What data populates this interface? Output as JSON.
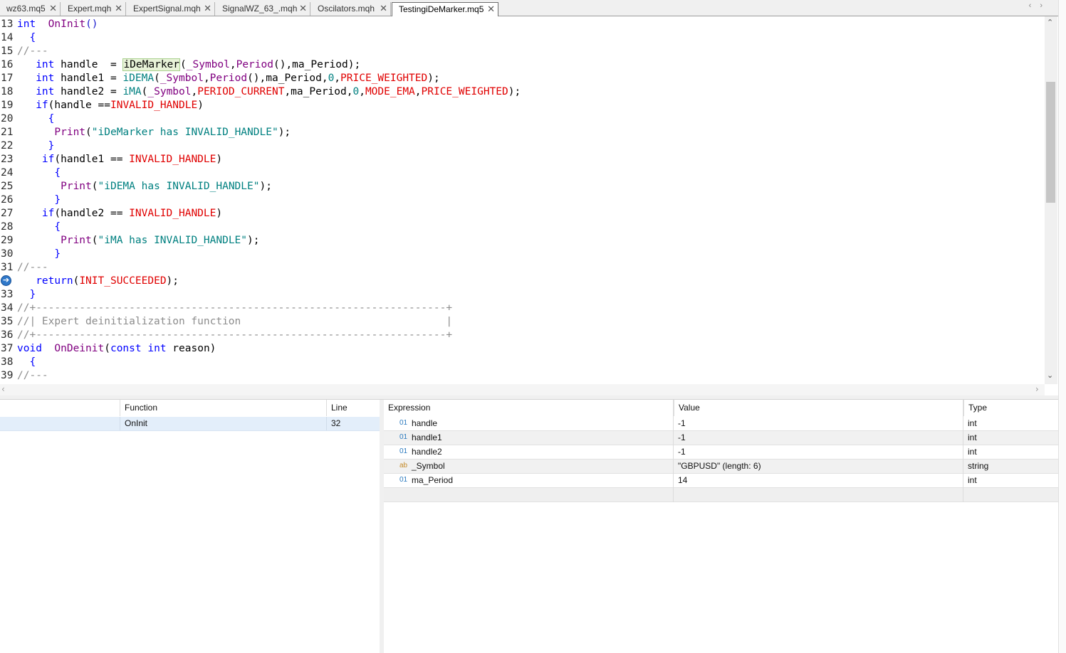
{
  "tabs": [
    {
      "label": "wz63.mq5",
      "active": false
    },
    {
      "label": "Expert.mqh",
      "active": false
    },
    {
      "label": "ExpertSignal.mqh",
      "active": false
    },
    {
      "label": "SignalWZ_63_.mqh",
      "active": false
    },
    {
      "label": "Oscilators.mqh",
      "active": false
    },
    {
      "label": "TestingiDeMarker.mq5",
      "active": true
    }
  ],
  "tab_close_glyph": "✕",
  "tab_nav": {
    "prev": "‹",
    "next": "›"
  },
  "code": {
    "lines": [
      {
        "n": "13",
        "tokens": [
          [
            "kw",
            "int"
          ],
          [
            "",
            "  "
          ],
          [
            "fn",
            "OnInit"
          ],
          [
            "bl",
            "()"
          ]
        ]
      },
      {
        "n": "14",
        "tokens": [
          [
            "",
            "  "
          ],
          [
            "kw",
            "{"
          ]
        ]
      },
      {
        "n": "15",
        "tokens": [
          [
            "cm",
            "//---"
          ]
        ]
      },
      {
        "n": "16",
        "tokens": [
          [
            "",
            "   "
          ],
          [
            "kw",
            "int"
          ],
          [
            "",
            " handle  = "
          ],
          [
            "hl",
            "iDeMarker"
          ],
          [
            "",
            "("
          ],
          [
            "fn",
            "_Symbol"
          ],
          [
            "",
            ","
          ],
          [
            "fn",
            "Period"
          ],
          [
            "",
            "(),ma_Period);"
          ]
        ]
      },
      {
        "n": "17",
        "tokens": [
          [
            "",
            "   "
          ],
          [
            "kw",
            "int"
          ],
          [
            "",
            " handle1 = "
          ],
          [
            "st",
            "iDEMA"
          ],
          [
            "",
            "("
          ],
          [
            "fn",
            "_Symbol"
          ],
          [
            "",
            ","
          ],
          [
            "fn",
            "Period"
          ],
          [
            "",
            "(),ma_Period,"
          ],
          [
            "st",
            "0"
          ],
          [
            "",
            ","
          ],
          [
            "cn",
            "PRICE_WEIGHTED"
          ],
          [
            "",
            ");"
          ]
        ]
      },
      {
        "n": "18",
        "tokens": [
          [
            "",
            "   "
          ],
          [
            "kw",
            "int"
          ],
          [
            "",
            " handle2 = "
          ],
          [
            "st",
            "iMA"
          ],
          [
            "",
            "("
          ],
          [
            "fn",
            "_Symbol"
          ],
          [
            "",
            ","
          ],
          [
            "cn",
            "PERIOD_CURRENT"
          ],
          [
            "",
            ",ma_Period,"
          ],
          [
            "st",
            "0"
          ],
          [
            "",
            ","
          ],
          [
            "cn",
            "MODE_EMA"
          ],
          [
            "",
            ","
          ],
          [
            "cn",
            "PRICE_WEIGHTED"
          ],
          [
            "",
            ");"
          ]
        ]
      },
      {
        "n": "19",
        "tokens": [
          [
            "",
            "   "
          ],
          [
            "kw",
            "if"
          ],
          [
            "",
            "(handle =="
          ],
          [
            "cn",
            "INVALID_HANDLE"
          ],
          [
            "",
            ")"
          ]
        ]
      },
      {
        "n": "20",
        "tokens": [
          [
            "",
            "     "
          ],
          [
            "kw",
            "{"
          ]
        ]
      },
      {
        "n": "21",
        "tokens": [
          [
            "",
            "      "
          ],
          [
            "fn",
            "Print"
          ],
          [
            "",
            "("
          ],
          [
            "st",
            "\"iDeMarker has INVALID_HANDLE\""
          ],
          [
            "",
            ");"
          ]
        ]
      },
      {
        "n": "22",
        "tokens": [
          [
            "",
            "     "
          ],
          [
            "kw",
            "}"
          ]
        ]
      },
      {
        "n": "23",
        "tokens": [
          [
            "",
            "    "
          ],
          [
            "kw",
            "if"
          ],
          [
            "",
            "(handle1 == "
          ],
          [
            "cn",
            "INVALID_HANDLE"
          ],
          [
            "",
            ")"
          ]
        ]
      },
      {
        "n": "24",
        "tokens": [
          [
            "",
            "      "
          ],
          [
            "kw",
            "{"
          ]
        ]
      },
      {
        "n": "25",
        "tokens": [
          [
            "",
            "       "
          ],
          [
            "fn",
            "Print"
          ],
          [
            "",
            "("
          ],
          [
            "st",
            "\"iDEMA has INVALID_HANDLE\""
          ],
          [
            "",
            ");"
          ]
        ]
      },
      {
        "n": "26",
        "tokens": [
          [
            "",
            "      "
          ],
          [
            "kw",
            "}"
          ]
        ]
      },
      {
        "n": "27",
        "tokens": [
          [
            "",
            "    "
          ],
          [
            "kw",
            "if"
          ],
          [
            "",
            "(handle2 == "
          ],
          [
            "cn",
            "INVALID_HANDLE"
          ],
          [
            "",
            ")"
          ]
        ]
      },
      {
        "n": "28",
        "tokens": [
          [
            "",
            "      "
          ],
          [
            "kw",
            "{"
          ]
        ]
      },
      {
        "n": "29",
        "tokens": [
          [
            "",
            "       "
          ],
          [
            "fn",
            "Print"
          ],
          [
            "",
            "("
          ],
          [
            "st",
            "\"iMA has INVALID_HANDLE\""
          ],
          [
            "",
            ");"
          ]
        ]
      },
      {
        "n": "30",
        "tokens": [
          [
            "",
            "      "
          ],
          [
            "kw",
            "}"
          ]
        ]
      },
      {
        "n": "31",
        "tokens": [
          [
            "cm",
            "//---"
          ]
        ]
      },
      {
        "n": "",
        "exec": true,
        "tokens": [
          [
            "",
            "   "
          ],
          [
            "kw",
            "return"
          ],
          [
            "",
            "("
          ],
          [
            "cn",
            "INIT_SUCCEEDED"
          ],
          [
            "",
            ");"
          ]
        ]
      },
      {
        "n": "33",
        "tokens": [
          [
            "",
            "  "
          ],
          [
            "kw",
            "}"
          ]
        ]
      },
      {
        "n": "34",
        "tokens": [
          [
            "cm",
            "//+------------------------------------------------------------------+"
          ]
        ]
      },
      {
        "n": "35",
        "tokens": [
          [
            "cm",
            "//| Expert deinitialization function                                 |"
          ]
        ]
      },
      {
        "n": "36",
        "tokens": [
          [
            "cm",
            "//+------------------------------------------------------------------+"
          ]
        ]
      },
      {
        "n": "37",
        "tokens": [
          [
            "kw",
            "void"
          ],
          [
            "",
            ""
          ],
          [
            "",
            "  "
          ],
          [
            "fn",
            "OnDeinit"
          ],
          [
            "",
            "("
          ],
          [
            "kw",
            "const"
          ],
          [
            "",
            " "
          ],
          [
            "kw",
            "int"
          ],
          [
            "",
            " reason)"
          ]
        ]
      },
      {
        "n": "38",
        "tokens": [
          [
            "",
            "  "
          ],
          [
            "kw",
            "{"
          ]
        ]
      },
      {
        "n": "39",
        "tokens": [
          [
            "cm",
            "//---"
          ]
        ]
      }
    ]
  },
  "exec_arrow_glyph": "➔",
  "callstack": {
    "headers": {
      "function": "Function",
      "line": "Line"
    },
    "rows": [
      {
        "function": "OnInit",
        "line": "32"
      }
    ]
  },
  "watch": {
    "headers": {
      "expression": "Expression",
      "value": "Value",
      "type": "Type"
    },
    "rows": [
      {
        "icon": "01",
        "expression": "handle",
        "value": "-1",
        "type": "int"
      },
      {
        "icon": "01",
        "expression": "handle1",
        "value": "-1",
        "type": "int"
      },
      {
        "icon": "01",
        "expression": "handle2",
        "value": "-1",
        "type": "int"
      },
      {
        "icon": "ab",
        "expression": "_Symbol",
        "value": "\"GBPUSD\" (length: 6)",
        "type": "string"
      },
      {
        "icon": "01",
        "expression": "ma_Period",
        "value": "14",
        "type": "int"
      }
    ]
  },
  "scroll_glyphs": {
    "up": "⌃",
    "down": "⌄",
    "left": "‹",
    "right": "›"
  }
}
